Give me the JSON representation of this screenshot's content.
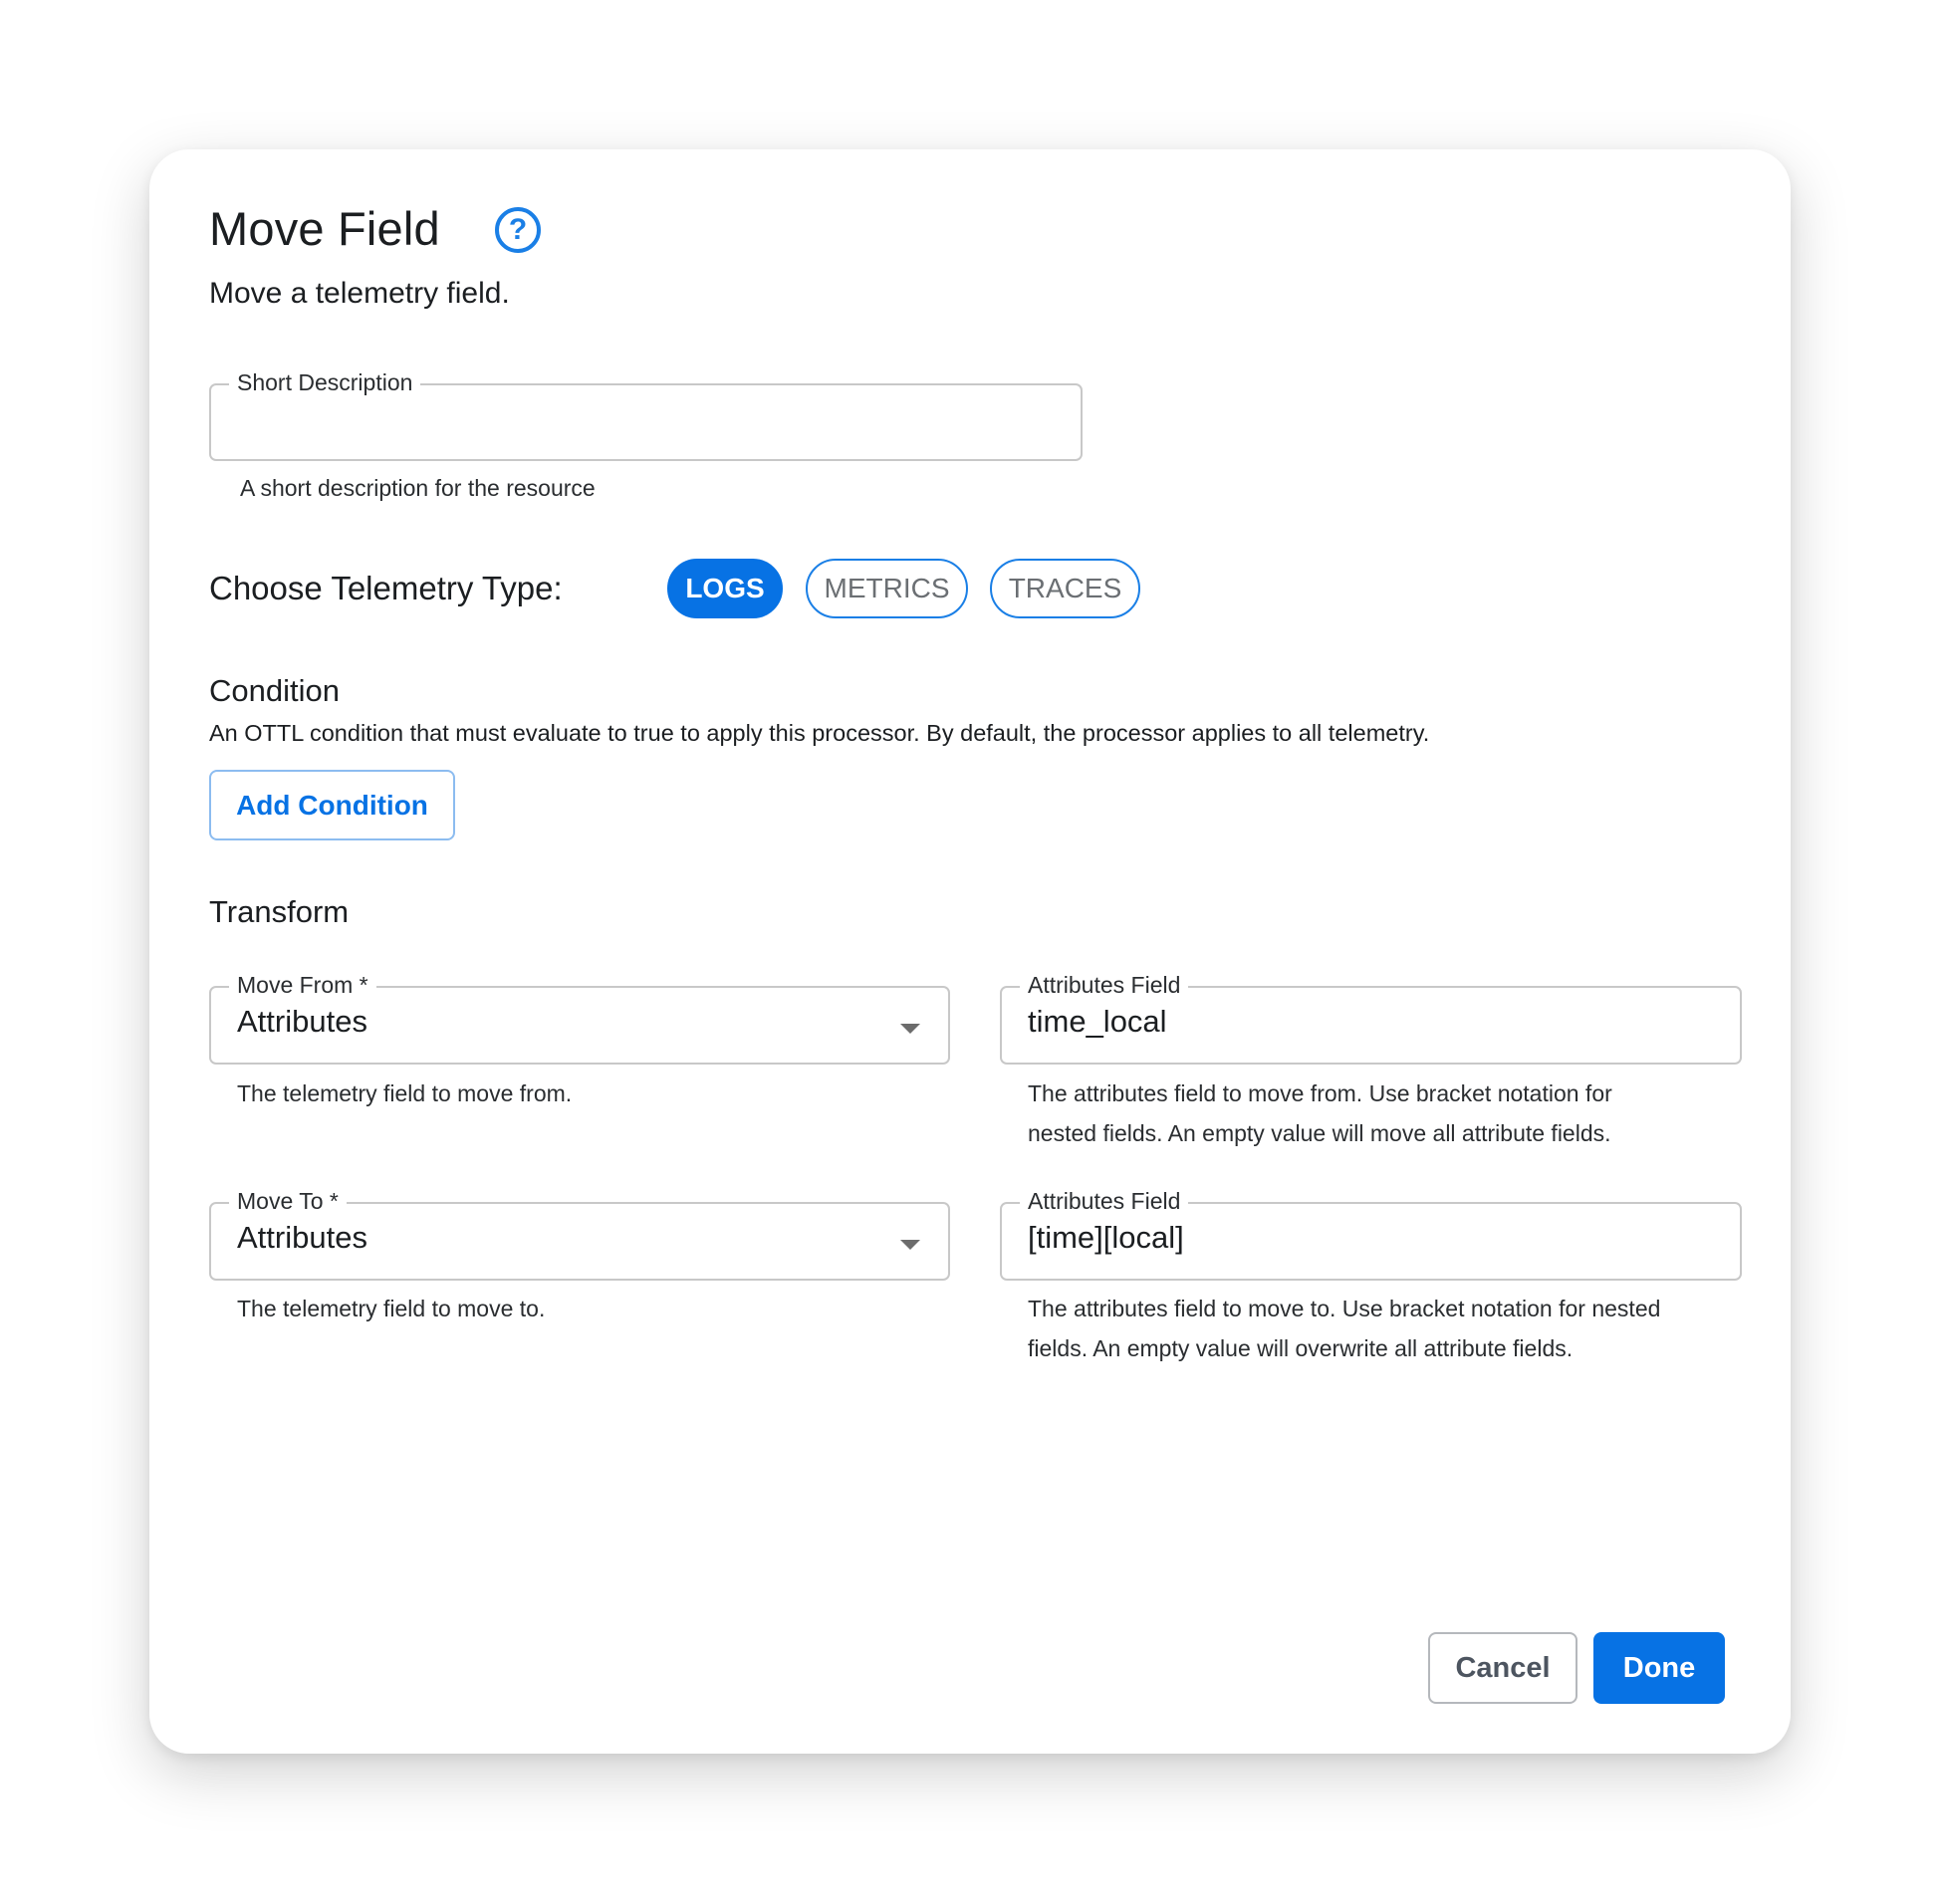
{
  "dialog": {
    "title": "Move Field",
    "help_icon": "help-circle-icon",
    "subtitle": "Move a telemetry field."
  },
  "short_description": {
    "label": "Short Description",
    "value": "",
    "helper": "A short description for the resource"
  },
  "telemetry": {
    "label": "Choose Telemetry Type:",
    "options": [
      {
        "label": "LOGS",
        "selected": true
      },
      {
        "label": "METRICS",
        "selected": false
      },
      {
        "label": "TRACES",
        "selected": false
      }
    ]
  },
  "condition": {
    "heading": "Condition",
    "description": "An OTTL condition that must evaluate to true to apply this processor. By default, the processor applies to all telemetry.",
    "add_button": "Add Condition"
  },
  "transform": {
    "heading": "Transform",
    "move_from": {
      "label": "Move From *",
      "value": "Attributes",
      "helper": "The telemetry field to move from."
    },
    "from_attributes": {
      "label": "Attributes Field",
      "value": "time_local",
      "helper_line1": "The attributes field to move from. Use bracket notation for",
      "helper_line2": "nested fields. An empty value will move all attribute fields."
    },
    "move_to": {
      "label": "Move To *",
      "value": "Attributes",
      "helper": "The telemetry field to move to."
    },
    "to_attributes": {
      "label": "Attributes Field",
      "value": "[time][local]",
      "helper_line1": "The attributes field to move to. Use bracket notation for nested",
      "helper_line2": "fields. An empty value will overwrite all attribute fields."
    }
  },
  "footer": {
    "cancel": "Cancel",
    "done": "Done"
  },
  "colors": {
    "accent": "#0772e4",
    "border": "#c8c8c8",
    "text": "#1b1e21"
  }
}
